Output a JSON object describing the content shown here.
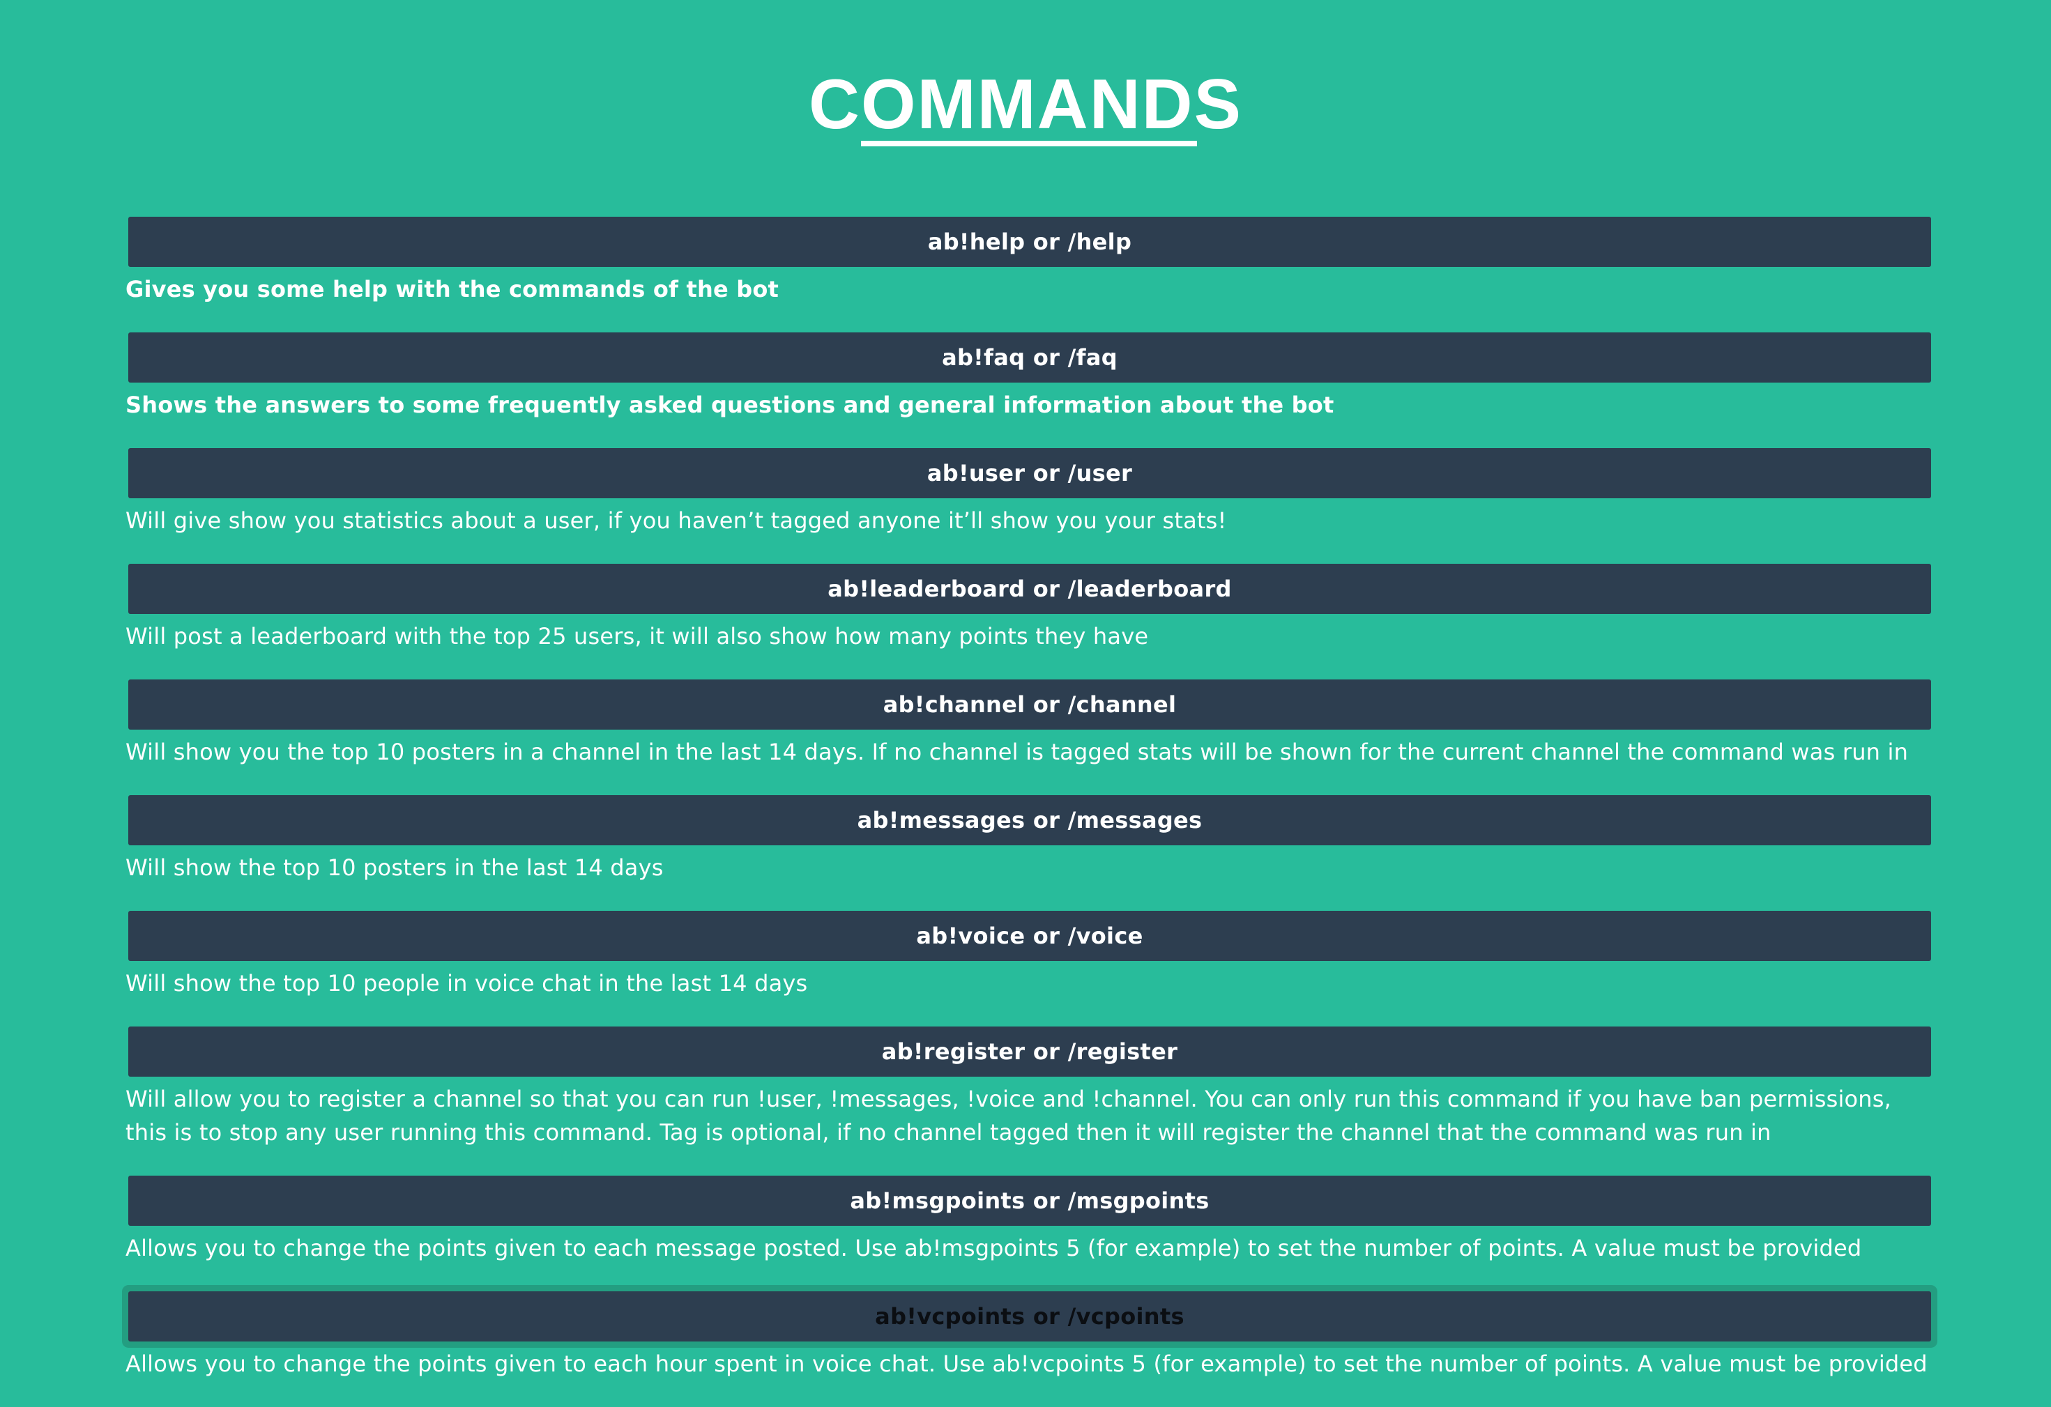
{
  "page": {
    "title": "COMMANDS"
  },
  "colors": {
    "background": "#28bc9b",
    "header_bar": "#2d3e50",
    "text": "#ffffff"
  },
  "commands": [
    {
      "name": "ab!help or /help",
      "description": "Gives you some help with the commands of the bot",
      "description_bold": true
    },
    {
      "name": "ab!faq or /faq",
      "description": "Shows the answers to some frequently asked questions and general information about the bot",
      "description_bold": true
    },
    {
      "name": "ab!user or /user",
      "description": "Will give show you statistics about a user, if you haven’t tagged anyone it’ll show you your stats!"
    },
    {
      "name": "ab!leaderboard or /leaderboard",
      "description": "Will post a leaderboard with the top 25 users, it will also show how many points they have"
    },
    {
      "name": "ab!channel or /channel",
      "description": "Will show you the top 10 posters in a channel in the last 14 days. If no channel is tagged stats will be shown for the current channel the command was run in"
    },
    {
      "name": "ab!messages or /messages",
      "description": "Will show the top 10 posters in the last 14 days"
    },
    {
      "name": "ab!voice or /voice",
      "description": "Will show the top 10 people in voice chat in the last 14 days"
    },
    {
      "name": "ab!register or /register",
      "description": "Will allow you to register a channel so that you can run !user, !messages, !voice and !channel. You can only run this command if you have ban permissions, this is to stop any user running this command. Tag is optional, if no channel tagged then it will register the channel that the command was run in"
    },
    {
      "name": "ab!msgpoints or /msgpoints",
      "description": "Allows you to change the points given to each message posted. Use ab!msgpoints 5 (for example) to set the number of points. A value must be provided"
    },
    {
      "name": "ab!vcpoints or /vcpoints",
      "description": "Allows you to change the points given to each hour spent in voice chat. Use ab!vcpoints 5 (for example) to set the number of points. A value must be provided",
      "active": true
    }
  ]
}
